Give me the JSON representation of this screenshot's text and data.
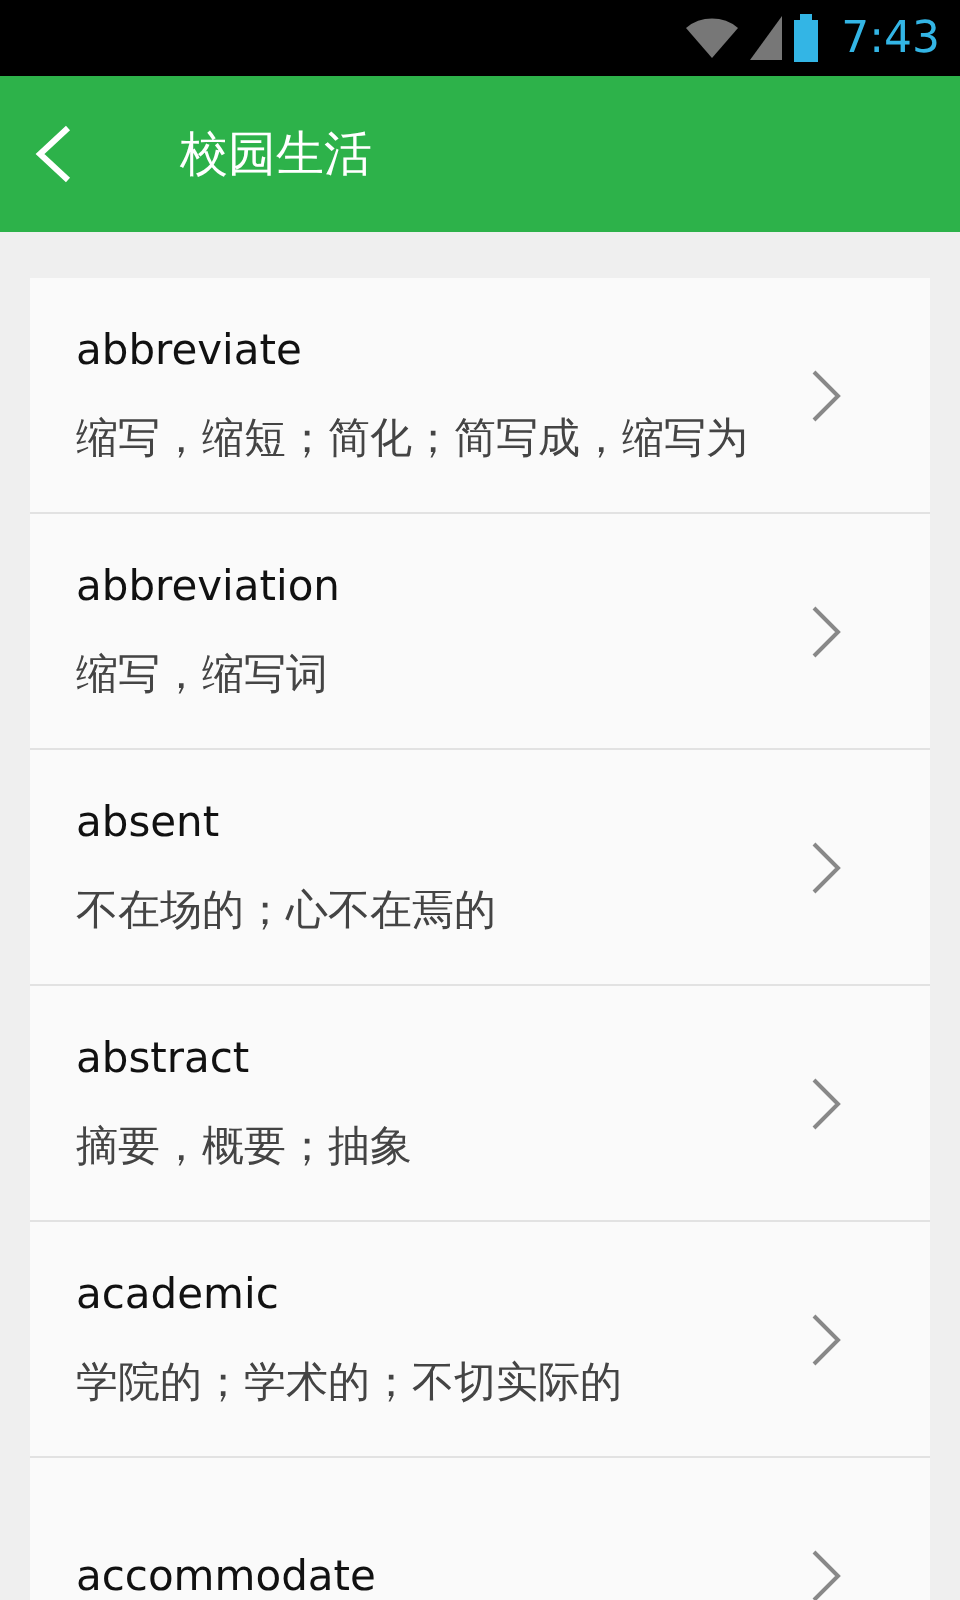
{
  "status_bar": {
    "time": "7:43"
  },
  "header": {
    "title": "校园生活"
  },
  "words": [
    {
      "word": "abbreviate",
      "meaning": "缩写，缩短；简化；简写成，缩写为"
    },
    {
      "word": "abbreviation",
      "meaning": "缩写，缩写词"
    },
    {
      "word": "absent",
      "meaning": "不在场的；心不在焉的"
    },
    {
      "word": "abstract",
      "meaning": "摘要，概要；抽象"
    },
    {
      "word": "academic",
      "meaning": "学院的；学术的；不切实际的"
    },
    {
      "word": "accommodate"
    }
  ]
}
